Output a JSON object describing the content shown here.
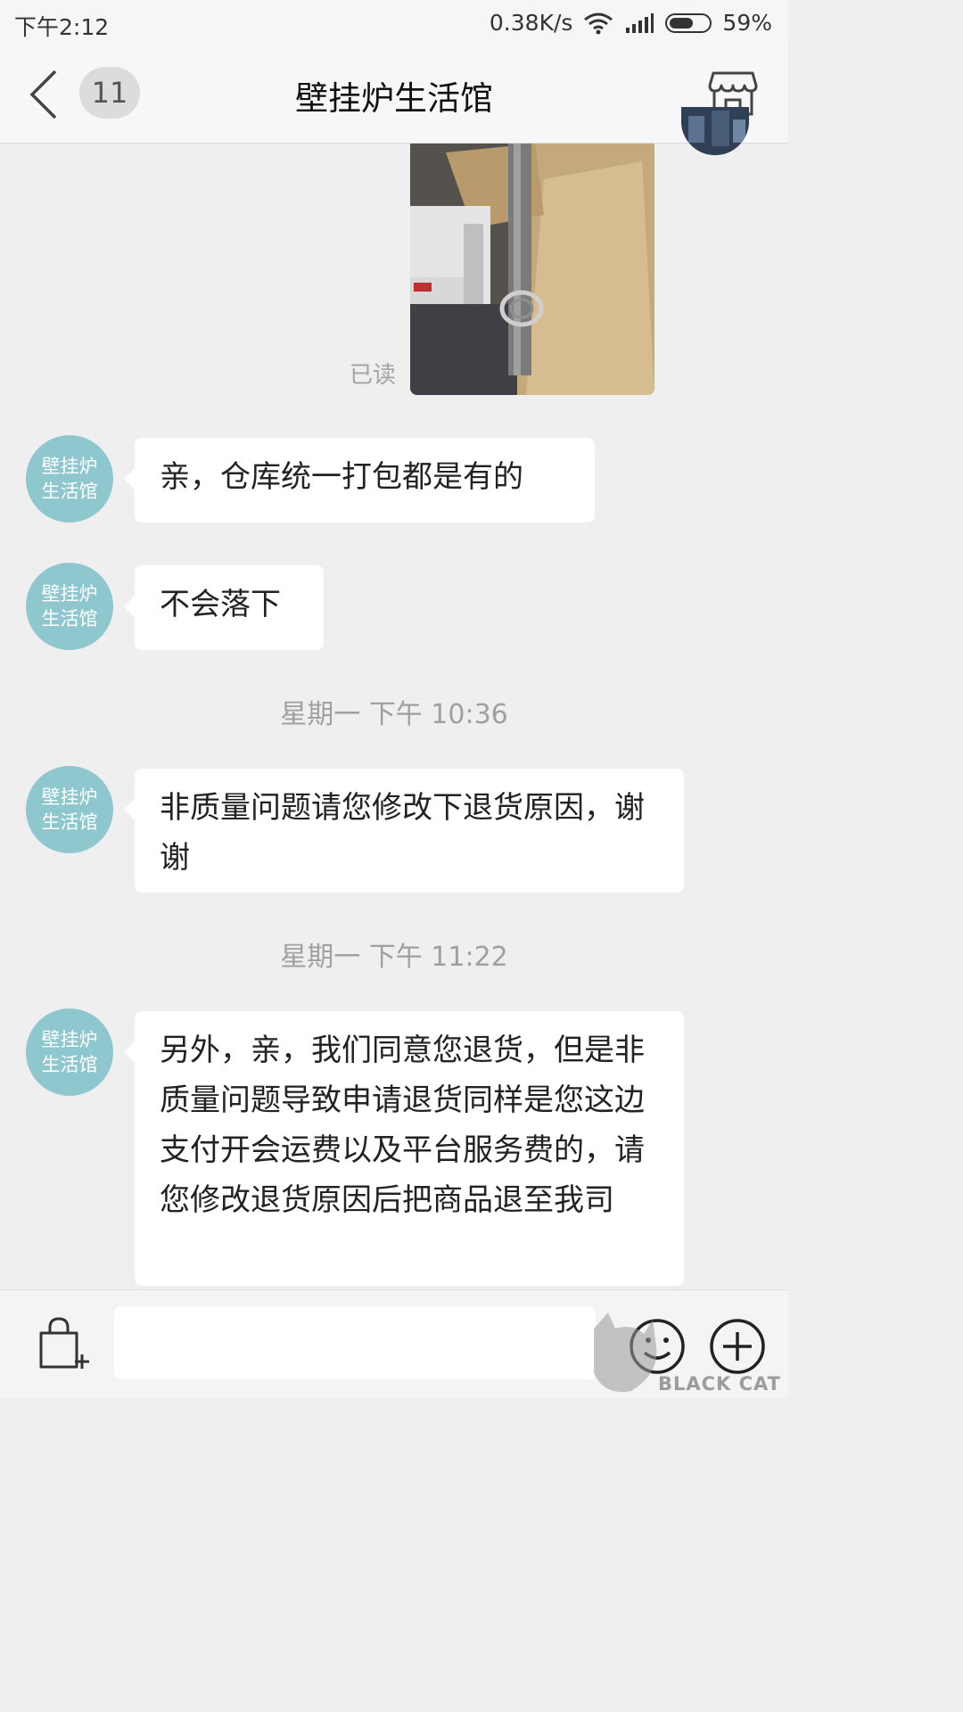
{
  "status_bar": {
    "time": "下午2:12",
    "network_speed": "0.38K/s",
    "battery": "59%",
    "battery_level": 0.59
  },
  "nav": {
    "unread_count": "11",
    "title": "壁挂炉生活馆"
  },
  "shop_avatar_text": "壁挂炉生活馆",
  "image_message": {
    "read_status": "已读"
  },
  "messages": [
    {
      "text": "亲，仓库统一打包都是有的"
    },
    {
      "text": "不会落下"
    },
    {
      "timestamp": "星期一 下午 10:36"
    },
    {
      "text": "非质量问题请您修改下退货原因，谢谢"
    },
    {
      "timestamp": "星期一 下午 11:22"
    },
    {
      "text": "另外，亲，我们同意您退货，但是非质量问题导致申请退货同样是您这边支付开会运费以及平台服务费的，请您修改退货原因后把商品退至我司"
    }
  ],
  "input": {
    "value": "",
    "placeholder": ""
  },
  "watermark": {
    "text": "BLACK CAT"
  },
  "colors": {
    "background": "#efefef",
    "avatar": "#8fc7cf",
    "bubble": "#ffffff",
    "secondary_text": "#a0a0a0"
  }
}
